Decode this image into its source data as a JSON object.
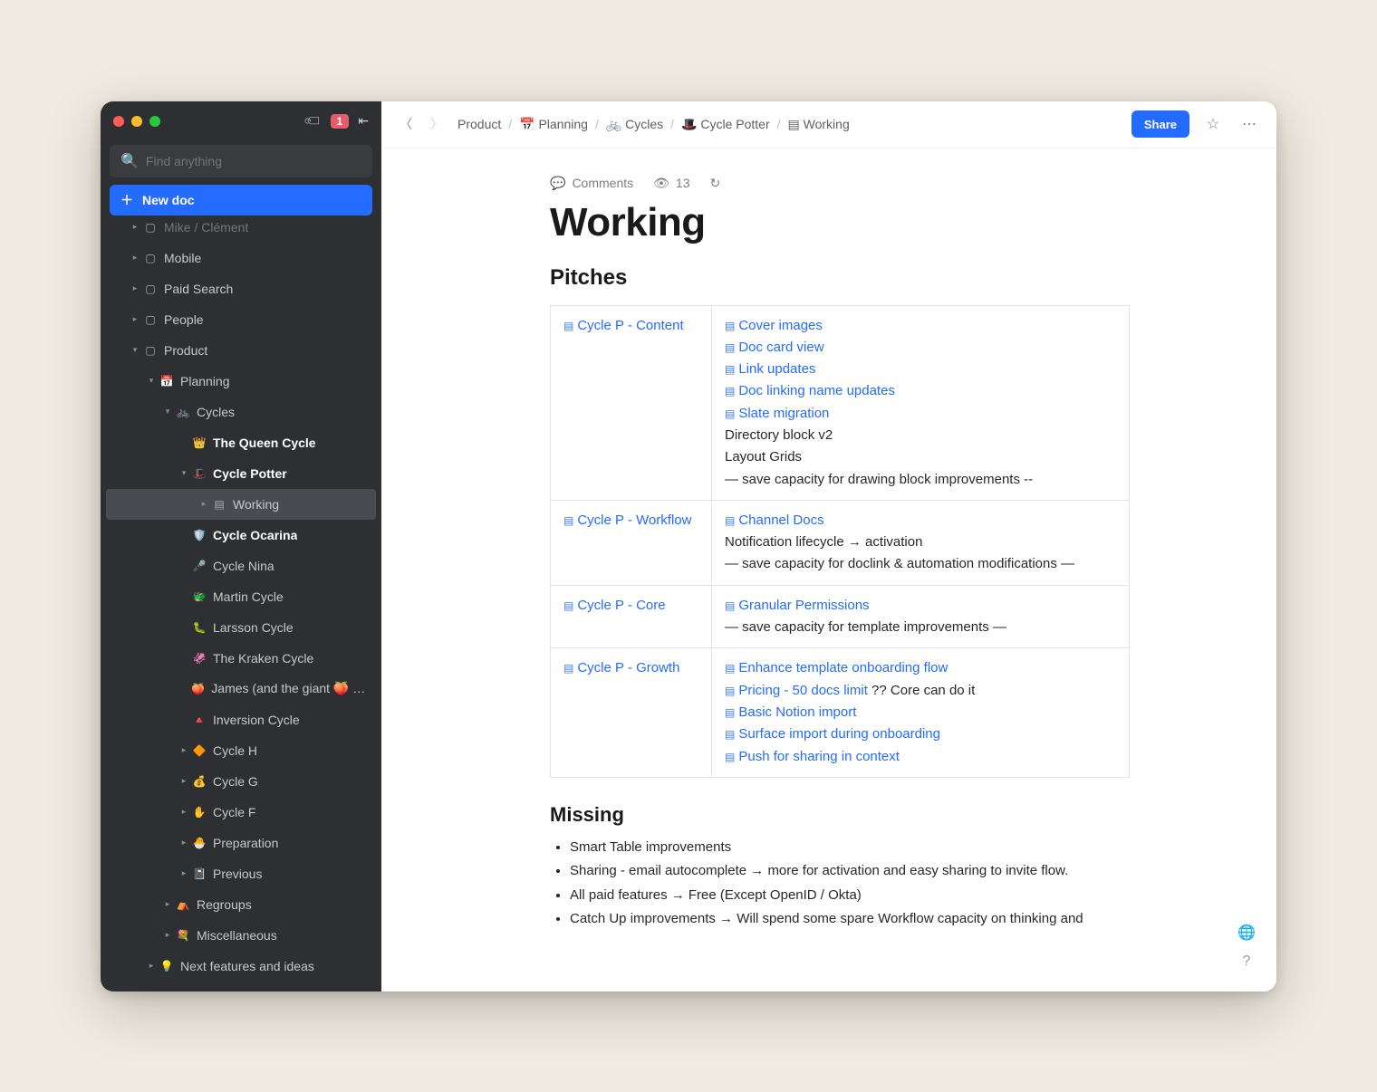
{
  "titlebar": {
    "badge": "1"
  },
  "search": {
    "placeholder": "Find anything"
  },
  "newdoc": {
    "label": "New doc"
  },
  "tree": [
    {
      "ind": 2,
      "caret": "right",
      "icon": "▢",
      "label": "Mike / Clément",
      "dim": true
    },
    {
      "ind": 2,
      "caret": "right",
      "icon": "▢",
      "label": "Mobile"
    },
    {
      "ind": 2,
      "caret": "right",
      "icon": "▢",
      "label": "Paid Search"
    },
    {
      "ind": 2,
      "caret": "right",
      "icon": "▢",
      "label": "People"
    },
    {
      "ind": 2,
      "caret": "down",
      "icon": "▢",
      "label": "Product"
    },
    {
      "ind": 3,
      "caret": "down",
      "icon": "📅",
      "label": "Planning"
    },
    {
      "ind": 4,
      "caret": "down",
      "icon": "🚲",
      "label": "Cycles"
    },
    {
      "ind": 5,
      "caret": "none",
      "icon": "👑",
      "label": "The Queen Cycle",
      "bold": true
    },
    {
      "ind": 5,
      "caret": "down",
      "icon": "🎩",
      "label": "Cycle Potter",
      "bold": true
    },
    {
      "ind": 6,
      "caret": "right",
      "icon": "▤",
      "label": "Working",
      "active": true
    },
    {
      "ind": 5,
      "caret": "none",
      "icon": "🛡️",
      "label": "Cycle Ocarina",
      "bold": true
    },
    {
      "ind": 5,
      "caret": "none",
      "icon": "🎤",
      "label": "Cycle Nina"
    },
    {
      "ind": 5,
      "caret": "none",
      "icon": "🐲",
      "label": "Martin Cycle"
    },
    {
      "ind": 5,
      "caret": "none",
      "icon": "🐛",
      "label": "Larsson Cycle"
    },
    {
      "ind": 5,
      "caret": "none",
      "icon": "🦑",
      "label": "The Kraken Cycle"
    },
    {
      "ind": 5,
      "caret": "none",
      "icon": "🍑",
      "label": "James (and the giant 🍑 Cy…"
    },
    {
      "ind": 5,
      "caret": "none",
      "icon": "🔺",
      "label": "Inversion Cycle"
    },
    {
      "ind": 5,
      "caret": "right",
      "icon": "🔶",
      "label": "Cycle H"
    },
    {
      "ind": 5,
      "caret": "right",
      "icon": "💰",
      "label": "Cycle G"
    },
    {
      "ind": 5,
      "caret": "right",
      "icon": "✋",
      "label": "Cycle F"
    },
    {
      "ind": 5,
      "caret": "right",
      "icon": "🐣",
      "label": "Preparation"
    },
    {
      "ind": 5,
      "caret": "right",
      "icon": "📓",
      "label": "Previous"
    },
    {
      "ind": 4,
      "caret": "right",
      "icon": "⛺",
      "label": "Regroups"
    },
    {
      "ind": 4,
      "caret": "right",
      "icon": "💐",
      "label": "Miscellaneous"
    },
    {
      "ind": 3,
      "caret": "right",
      "icon": "💡",
      "label": "Next features and ideas"
    }
  ],
  "breadcrumbs": [
    {
      "icon": "",
      "label": "Product"
    },
    {
      "icon": "📅",
      "label": "Planning"
    },
    {
      "icon": "🚲",
      "label": "Cycles"
    },
    {
      "icon": "🎩",
      "label": "Cycle Potter"
    },
    {
      "icon": "▤",
      "label": "Working"
    }
  ],
  "actions": {
    "share": "Share"
  },
  "meta": {
    "comments": "Comments",
    "views": "13"
  },
  "page": {
    "title": "Working",
    "h_pitches": "Pitches",
    "h_missing": "Missing"
  },
  "pitches": [
    {
      "name": "Cycle P - Content",
      "items": [
        {
          "t": "link",
          "v": "Cover images"
        },
        {
          "t": "link",
          "v": "Doc card view"
        },
        {
          "t": "link",
          "v": "Link updates"
        },
        {
          "t": "link",
          "v": "Doc linking name updates"
        },
        {
          "t": "link",
          "v": "Slate migration"
        },
        {
          "t": "text",
          "v": "Directory block v2"
        },
        {
          "t": "text",
          "v": "Layout Grids"
        },
        {
          "t": "text",
          "v": "— save capacity for drawing block improvements --"
        }
      ]
    },
    {
      "name": "Cycle P - Workflow",
      "items": [
        {
          "t": "link",
          "v": "Channel Docs"
        },
        {
          "t": "text",
          "v": "Notification lifecycle → activation"
        },
        {
          "t": "text",
          "v": "— save capacity for doclink & automation modifications —"
        }
      ]
    },
    {
      "name": "Cycle P - Core",
      "items": [
        {
          "t": "link",
          "v": "Granular Permissions"
        },
        {
          "t": "text",
          "v": "— save capacity for template improvements —"
        }
      ]
    },
    {
      "name": "Cycle P - Growth",
      "items": [
        {
          "t": "link",
          "v": "Enhance template onboarding flow"
        },
        {
          "t": "mixed",
          "link": "Pricing - 50 docs limit",
          "tail": "  ?? Core can do it"
        },
        {
          "t": "link",
          "v": "Basic Notion import"
        },
        {
          "t": "link",
          "v": "Surface import during onboarding"
        },
        {
          "t": "link",
          "v": "Push for sharing in context"
        }
      ]
    }
  ],
  "missing": [
    "Smart Table improvements",
    "Sharing - email autocomplete → more for activation and easy sharing to invite flow.",
    "All paid features → Free (Except OpenID / Okta)",
    "Catch Up improvements → Will spend some spare Workflow capacity on thinking and"
  ]
}
